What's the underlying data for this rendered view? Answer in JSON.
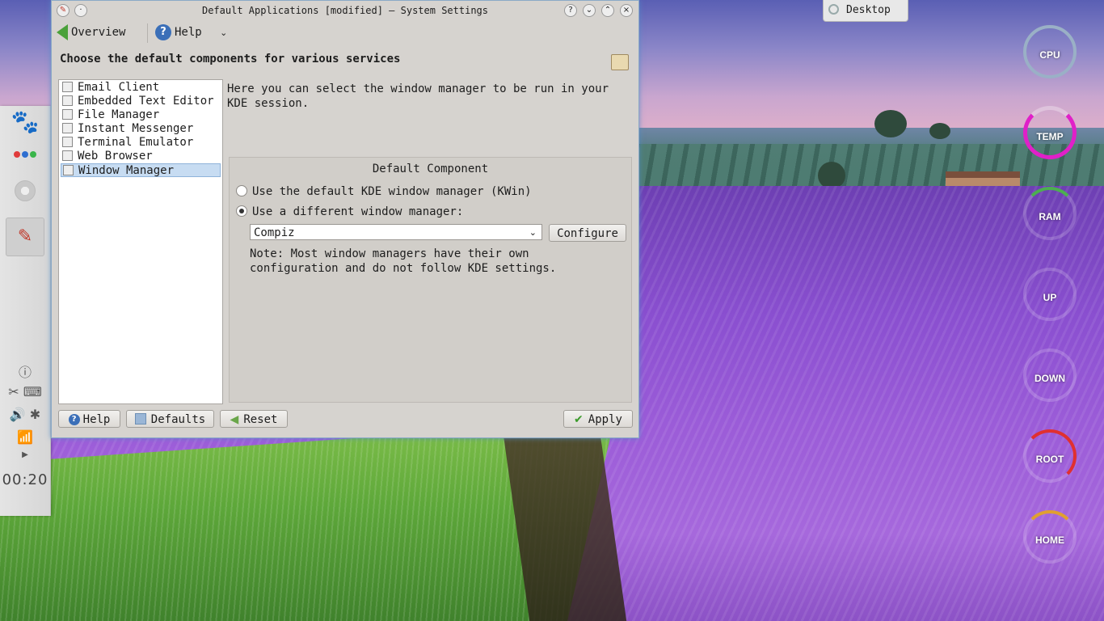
{
  "window": {
    "title": "Default Applications [modified] – System Settings",
    "toolbar": {
      "overview": "Overview",
      "help": "Help"
    },
    "heading": "Choose the default components for various services",
    "list": [
      {
        "label": "Email Client",
        "icon": "email-icon",
        "selected": false
      },
      {
        "label": "Embedded Text Editor",
        "icon": "text-editor-icon",
        "selected": false
      },
      {
        "label": "File Manager",
        "icon": "file-manager-icon",
        "selected": false
      },
      {
        "label": "Instant Messenger",
        "icon": "messenger-icon",
        "selected": false
      },
      {
        "label": "Terminal Emulator",
        "icon": "terminal-icon",
        "selected": false
      },
      {
        "label": "Web Browser",
        "icon": "globe-icon",
        "selected": false
      },
      {
        "label": "Window Manager",
        "icon": "window-icon",
        "selected": true
      }
    ],
    "description": "Here you can select the window manager to be run in your KDE session.",
    "group": {
      "title": "Default Component",
      "option_default": "Use the default KDE window manager (KWin)",
      "option_different": "Use a different window manager:",
      "selected_option": "different",
      "select_value": "Compiz",
      "configure": "Configure",
      "note": "Note: Most window managers have their own configuration and do not follow KDE settings."
    },
    "buttons": {
      "help": "Help",
      "defaults": "Defaults",
      "reset": "Reset",
      "apply": "Apply"
    }
  },
  "desktop_widget": {
    "label": "Desktop"
  },
  "monitors": [
    {
      "label": "CPU",
      "color": "#9ab0c6"
    },
    {
      "label": "TEMP",
      "color": "#e020c8"
    },
    {
      "label": "RAM",
      "color": "#4caf50"
    },
    {
      "label": "UP",
      "color": "#888888"
    },
    {
      "label": "DOWN",
      "color": "#888888"
    },
    {
      "label": "ROOT",
      "color": "#e03030"
    },
    {
      "label": "HOME",
      "color": "#e0a030"
    }
  ],
  "panel": {
    "clock": "00:20"
  }
}
